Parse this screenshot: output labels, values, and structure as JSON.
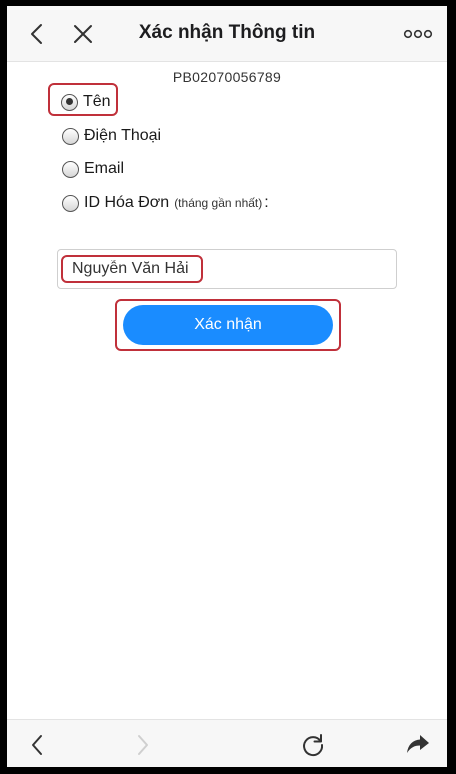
{
  "header": {
    "title": "Xác nhận Thông tin"
  },
  "form": {
    "code": "PB02070056789",
    "options": [
      {
        "label": "Tên",
        "checked": true
      },
      {
        "label": "Điện Thoại",
        "checked": false
      },
      {
        "label": "Email",
        "checked": false
      },
      {
        "label": "ID Hóa Đơn",
        "hint": "(tháng gần nhất)",
        "suffix": ":",
        "checked": false
      }
    ],
    "name_value": "Nguyễn Văn Hải",
    "confirm_label": "Xác nhận"
  },
  "colors": {
    "accent": "#1a8cff",
    "highlight": "#c0303a"
  },
  "icons": {
    "header_left": [
      "chevron-left-icon",
      "close-icon"
    ],
    "header_right": "more-icon",
    "footer": [
      "chevron-left-icon",
      "chevron-right-icon",
      "reload-icon",
      "share-icon"
    ]
  }
}
